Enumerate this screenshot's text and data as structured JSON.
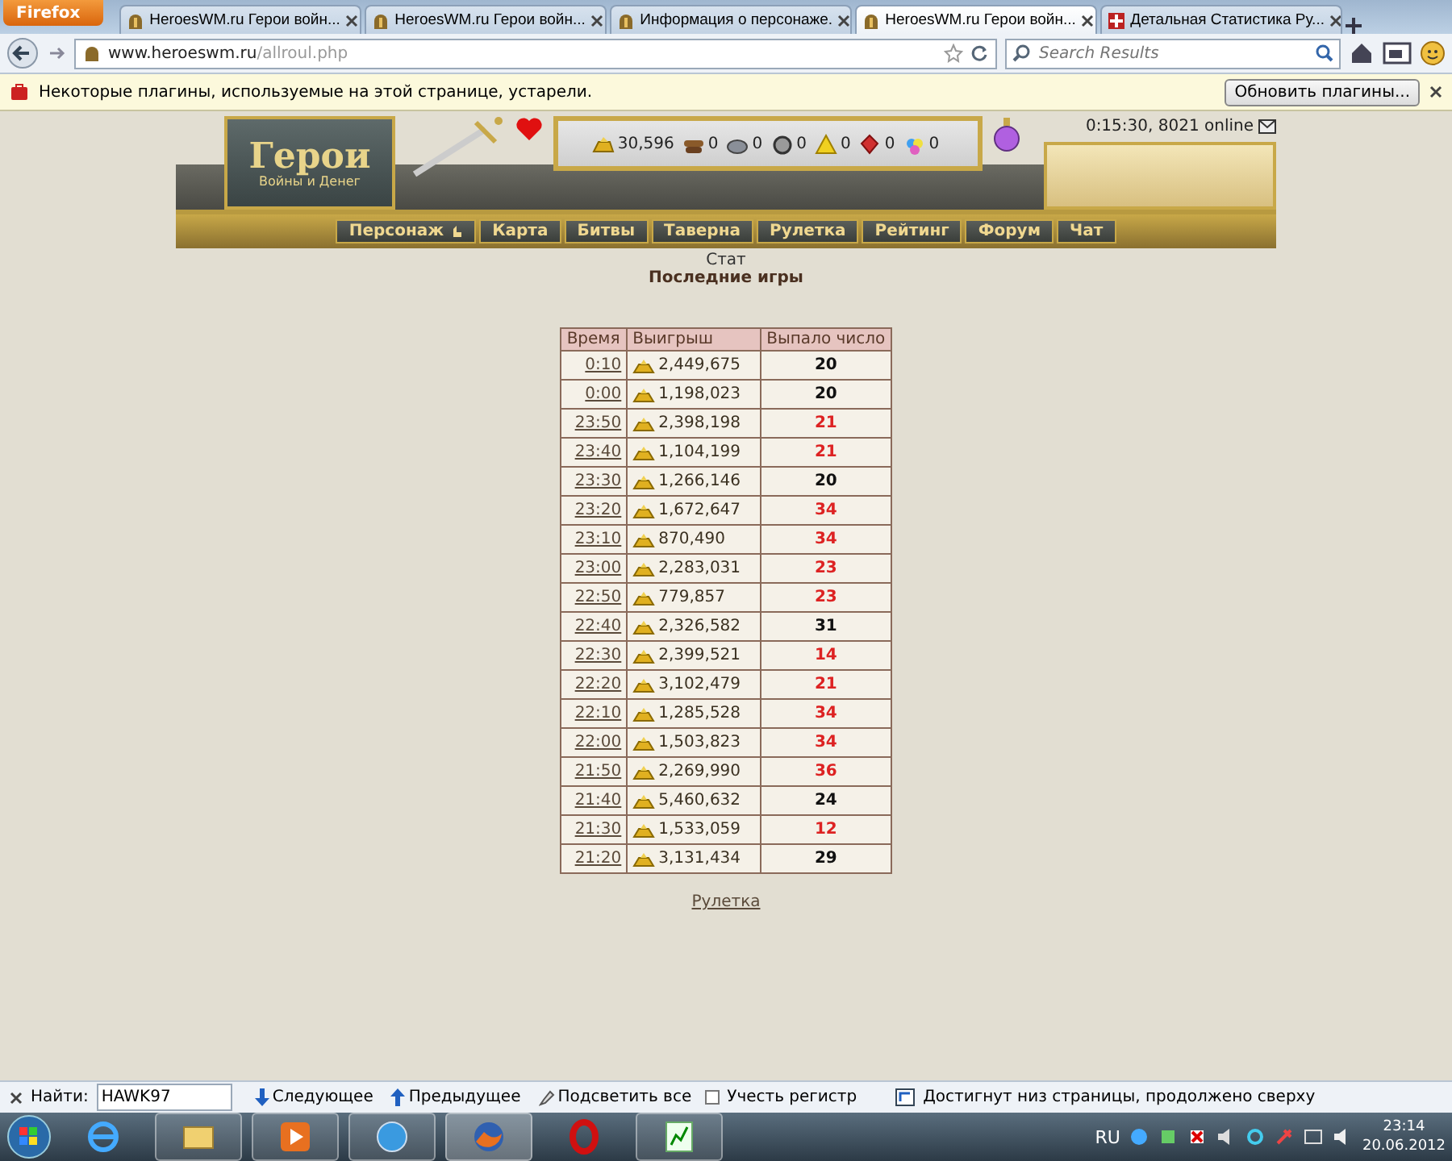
{
  "browser": {
    "app_button": "Firefox",
    "tabs": [
      {
        "title": "HeroesWM.ru Герои войн...",
        "selected": false
      },
      {
        "title": "HeroesWM.ru Герои войн...",
        "selected": false
      },
      {
        "title": "Информация о персонаже.",
        "selected": false
      },
      {
        "title": "HeroesWM.ru Герои войн...",
        "selected": true
      },
      {
        "title": "Детальная Статистика Ру...",
        "selected": false
      }
    ],
    "url_host": "www.heroeswm.ru",
    "url_path": "/allroul.php",
    "search": {
      "placeholder": "Search Results"
    }
  },
  "plugin_bar": {
    "message": "Некоторые плагины, используемые на этой странице, устарели.",
    "button": "Обновить плагины..."
  },
  "game_header": {
    "logo": "Герои",
    "logo_sub": "Войны и Денег",
    "clock": "0:15:30, 8021 online",
    "resources": [
      {
        "kind": "gold",
        "amount": "30,596"
      },
      {
        "kind": "wood",
        "amount": "0"
      },
      {
        "kind": "ore",
        "amount": "0"
      },
      {
        "kind": "mercury",
        "amount": "0"
      },
      {
        "kind": "sulfur",
        "amount": "0"
      },
      {
        "kind": "crystal",
        "amount": "0"
      },
      {
        "kind": "gems",
        "amount": "0"
      }
    ],
    "menu": [
      "Персонаж",
      "Карта",
      "Битвы",
      "Таверна",
      "Рулетка",
      "Рейтинг",
      "Форум",
      "Чат"
    ]
  },
  "page": {
    "subtitle": "Стат",
    "title": "Последние игры",
    "table": {
      "columns": [
        "Время",
        "Выигрыш",
        "Выпало число"
      ],
      "rows": [
        {
          "time": "0:10",
          "win": "2,449,675",
          "number": "20",
          "color": "#111111"
        },
        {
          "time": "0:00",
          "win": "1,198,023",
          "number": "20",
          "color": "#111111"
        },
        {
          "time": "23:50",
          "win": "2,398,198",
          "number": "21",
          "color": "#dd2222"
        },
        {
          "time": "23:40",
          "win": "1,104,199",
          "number": "21",
          "color": "#dd2222"
        },
        {
          "time": "23:30",
          "win": "1,266,146",
          "number": "20",
          "color": "#111111"
        },
        {
          "time": "23:20",
          "win": "1,672,647",
          "number": "34",
          "color": "#dd2222"
        },
        {
          "time": "23:10",
          "win": "870,490",
          "number": "34",
          "color": "#dd2222"
        },
        {
          "time": "23:00",
          "win": "2,283,031",
          "number": "23",
          "color": "#dd2222"
        },
        {
          "time": "22:50",
          "win": "779,857",
          "number": "23",
          "color": "#dd2222"
        },
        {
          "time": "22:40",
          "win": "2,326,582",
          "number": "31",
          "color": "#111111"
        },
        {
          "time": "22:30",
          "win": "2,399,521",
          "number": "14",
          "color": "#dd2222"
        },
        {
          "time": "22:20",
          "win": "3,102,479",
          "number": "21",
          "color": "#dd2222"
        },
        {
          "time": "22:10",
          "win": "1,285,528",
          "number": "34",
          "color": "#dd2222"
        },
        {
          "time": "22:00",
          "win": "1,503,823",
          "number": "34",
          "color": "#dd2222"
        },
        {
          "time": "21:50",
          "win": "2,269,990",
          "number": "36",
          "color": "#dd2222"
        },
        {
          "time": "21:40",
          "win": "5,460,632",
          "number": "24",
          "color": "#111111"
        },
        {
          "time": "21:30",
          "win": "1,533,059",
          "number": "12",
          "color": "#dd2222"
        },
        {
          "time": "21:20",
          "win": "3,131,434",
          "number": "29",
          "color": "#111111"
        }
      ]
    },
    "footer_link": "Рулетка"
  },
  "find_bar": {
    "label": "Найти:",
    "value": "HAWK97",
    "next": "Следующее",
    "prev": "Предыдущее",
    "highlight": "Подсветить все",
    "match_case": {
      "label": "Учесть регистр",
      "checked": false
    },
    "status": "Достигнут низ страницы, продолжено сверху"
  },
  "taskbar": {
    "language": "RU",
    "time": "23:14",
    "date": "20.06.2012"
  }
}
